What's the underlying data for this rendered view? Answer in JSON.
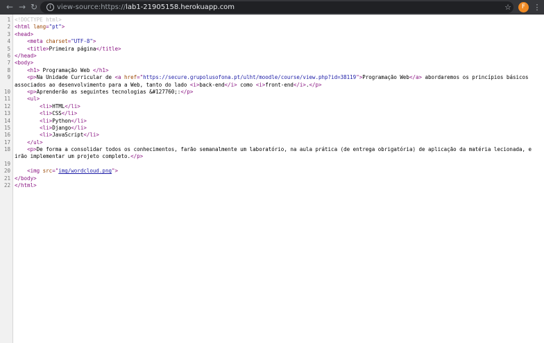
{
  "browser": {
    "back_icon": "arrow-left-icon",
    "forward_icon": "arrow-right-icon",
    "reload_icon": "reload-icon",
    "url_prefix": "view-source:https://",
    "url_host": "lab1-21905158.herokuapp.com",
    "bookmark_icon": "star-icon",
    "profile_initial": "F",
    "profile_color": "#f08a24",
    "menu_icon": "three-dots-icon"
  },
  "source": {
    "line_numbers": [
      "1",
      "2",
      "3",
      "4",
      "5",
      "6",
      "7",
      "8",
      "9",
      "10",
      "11",
      "12",
      "13",
      "14",
      "15",
      "16",
      "17",
      "18",
      "19",
      "20",
      "21",
      "22"
    ],
    "l1": {
      "doctype": "<!DOCTYPE html>"
    },
    "l2": {
      "open": "<html",
      "attr": "lang",
      "val": "\"pt\"",
      "close": ">"
    },
    "l3": {
      "tag": "<head>"
    },
    "l4": {
      "open": "<meta",
      "attr": "charset",
      "val": "\"UTF-8\"",
      "close": ">"
    },
    "l5": {
      "open": "<title>",
      "text": "Primeira página",
      "close": "</title>"
    },
    "l6": {
      "tag": "</head>"
    },
    "l7": {
      "tag": "<body>"
    },
    "l8": {
      "open": "<h1>",
      "text": " Programação Web ",
      "close": "</h1>"
    },
    "l9": {
      "p_open": "<p>",
      "text1": "Na Unidade Curricular de ",
      "a_open": "<a",
      "attr": "href",
      "href": "https://secure.grupolusofona.pt/ulht/moodle/course/view.php?id=38119",
      "a_close_bracket": ">",
      "link_text": "Programação Web",
      "a_end": "</a>",
      "text2": " abordaremos os princípios básicos associados ao desenvolvimento para a Web, tanto do lado ",
      "i1_open": "<i>",
      "i1_text": "back-end",
      "i1_close": "</i>",
      "text3": " como ",
      "i2_open": "<i>",
      "i2_text": "front-end",
      "i2_close": "</i>",
      "text4": ".",
      "p_close": "</p>"
    },
    "l10": {
      "open": "<p>",
      "text": "Aprenderão as seguintes tecnologias &#127760;:",
      "close": "</p>"
    },
    "l11": {
      "tag": "<ul>"
    },
    "list": [
      {
        "open": "<li>",
        "text": "HTML",
        "close": "</li>"
      },
      {
        "open": "<li>",
        "text": "CSS",
        "close": "</li>"
      },
      {
        "open": "<li>",
        "text": "Python",
        "close": "</li>"
      },
      {
        "open": "<li>",
        "text": "Django",
        "close": "</li>"
      },
      {
        "open": "<li>",
        "text": "JavaScript",
        "close": "</li>"
      }
    ],
    "l17": {
      "tag": "</ul>"
    },
    "l18": {
      "open": "<p>",
      "text": "De forma a consolidar todos os conhecimentos, farão semanalmente um laboratório, na aula prática (de entrega obrigatória) de aplicação da matéria lecionada, e irão implementar um projeto completo.",
      "close": "</p>"
    },
    "l20": {
      "open": "<img",
      "attr": "src",
      "eq_q": "=\"",
      "link": "img/wordcloud.png",
      "q": "\"",
      "close": ">"
    },
    "l21": {
      "tag": "</body>"
    },
    "l22": {
      "tag": "</html>"
    }
  }
}
